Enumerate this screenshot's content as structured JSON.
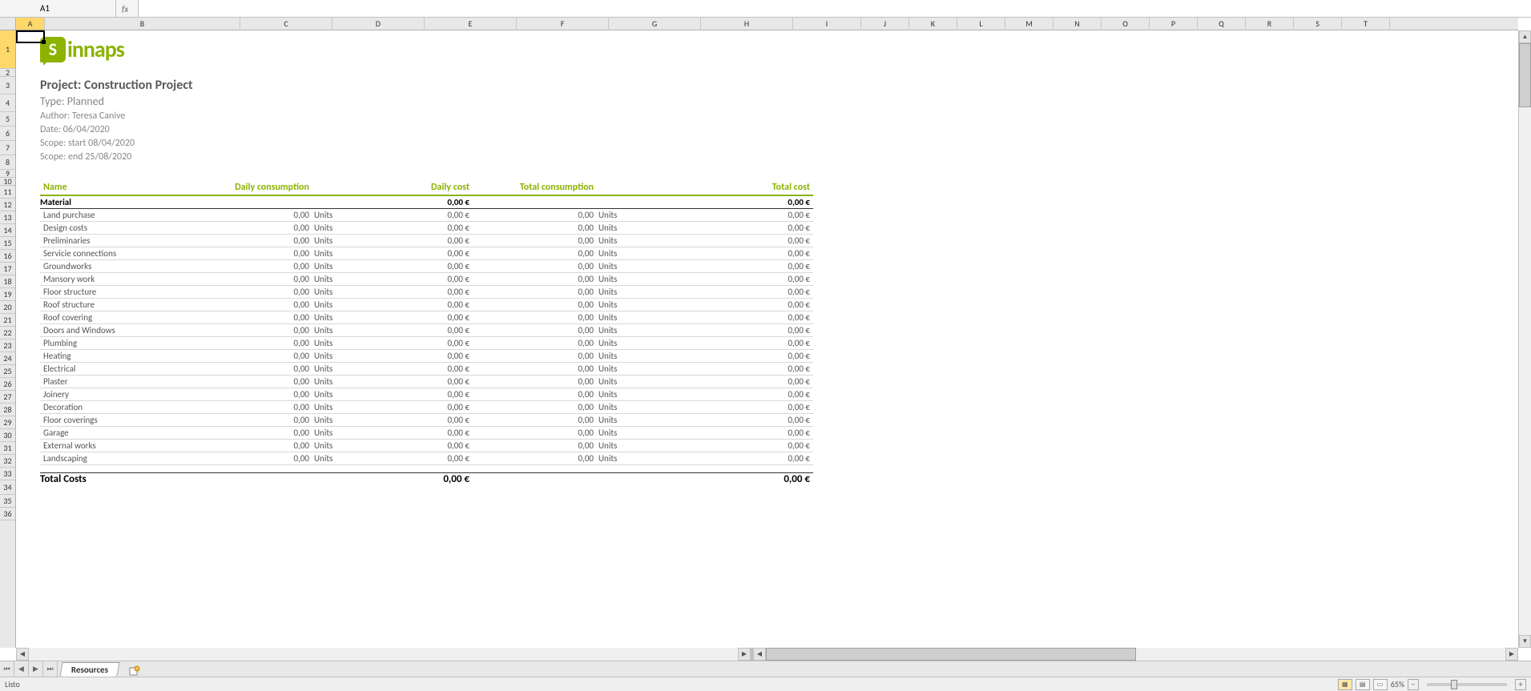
{
  "nameBox": "A1",
  "formula": "",
  "columns": [
    "A",
    "B",
    "C",
    "D",
    "E",
    "F",
    "G",
    "H",
    "I",
    "J",
    "K",
    "L",
    "M",
    "N",
    "O",
    "P",
    "Q",
    "R",
    "S",
    "T"
  ],
  "rowNums": [
    1,
    2,
    3,
    4,
    5,
    6,
    7,
    8,
    9,
    10,
    11,
    12,
    13,
    14,
    15,
    16,
    17,
    18,
    19,
    20,
    21,
    22,
    23,
    24,
    25,
    26,
    27,
    28,
    29,
    30,
    31,
    32,
    33,
    34,
    35,
    36
  ],
  "rowHeights": {
    "1": 48,
    "2": 10,
    "3": 22,
    "4": 22,
    "5": 18,
    "6": 18,
    "7": 18,
    "8": 18,
    "9": 10,
    "10": 10,
    "34": 18
  },
  "logoText": "innaps",
  "project": {
    "title": "Project: Construction Project",
    "type": "Type: Planned",
    "author": "Author: Teresa Canive",
    "date": "Date: 06/04/2020",
    "scopeStart": "Scope: start 08/04/2020",
    "scopeEnd": "Scope: end 25/08/2020"
  },
  "headers": {
    "name": "Name",
    "dailyCons": "Daily consumption",
    "dailyCost": "Daily cost",
    "totalCons": "Total consumption",
    "totalCost": "Total cost"
  },
  "section": {
    "label": "Material",
    "dailyCost": "0,00 €",
    "totalCost": "0,00 €"
  },
  "rows": [
    {
      "name": "Land purchase",
      "dc": "0,00",
      "du": "Units",
      "dcost": "0,00 €",
      "tc": "0,00",
      "tu": "Units",
      "tcost": "0,00 €"
    },
    {
      "name": "Design costs",
      "dc": "0,00",
      "du": "Units",
      "dcost": "0,00 €",
      "tc": "0,00",
      "tu": "Units",
      "tcost": "0,00 €"
    },
    {
      "name": "Preliminaries",
      "dc": "0,00",
      "du": "Units",
      "dcost": "0,00 €",
      "tc": "0,00",
      "tu": "Units",
      "tcost": "0,00 €"
    },
    {
      "name": "Servicie connections",
      "dc": "0,00",
      "du": "Units",
      "dcost": "0,00 €",
      "tc": "0,00",
      "tu": "Units",
      "tcost": "0,00 €"
    },
    {
      "name": "Groundworks",
      "dc": "0,00",
      "du": "Units",
      "dcost": "0,00 €",
      "tc": "0,00",
      "tu": "Units",
      "tcost": "0,00 €"
    },
    {
      "name": "Mansory work",
      "dc": "0,00",
      "du": "Units",
      "dcost": "0,00 €",
      "tc": "0,00",
      "tu": "Units",
      "tcost": "0,00 €"
    },
    {
      "name": "Floor structure",
      "dc": "0,00",
      "du": "Units",
      "dcost": "0,00 €",
      "tc": "0,00",
      "tu": "Units",
      "tcost": "0,00 €"
    },
    {
      "name": "Roof structure",
      "dc": "0,00",
      "du": "Units",
      "dcost": "0,00 €",
      "tc": "0,00",
      "tu": "Units",
      "tcost": "0,00 €"
    },
    {
      "name": "Roof covering",
      "dc": "0,00",
      "du": "Units",
      "dcost": "0,00 €",
      "tc": "0,00",
      "tu": "Units",
      "tcost": "0,00 €"
    },
    {
      "name": "Doors and Windows",
      "dc": "0,00",
      "du": "Units",
      "dcost": "0,00 €",
      "tc": "0,00",
      "tu": "Units",
      "tcost": "0,00 €"
    },
    {
      "name": "Plumbing",
      "dc": "0,00",
      "du": "Units",
      "dcost": "0,00 €",
      "tc": "0,00",
      "tu": "Units",
      "tcost": "0,00 €"
    },
    {
      "name": "Heating",
      "dc": "0,00",
      "du": "Units",
      "dcost": "0,00 €",
      "tc": "0,00",
      "tu": "Units",
      "tcost": "0,00 €"
    },
    {
      "name": "Electrical",
      "dc": "0,00",
      "du": "Units",
      "dcost": "0,00 €",
      "tc": "0,00",
      "tu": "Units",
      "tcost": "0,00 €"
    },
    {
      "name": "Plaster",
      "dc": "0,00",
      "du": "Units",
      "dcost": "0,00 €",
      "tc": "0,00",
      "tu": "Units",
      "tcost": "0,00 €"
    },
    {
      "name": "Joinery",
      "dc": "0,00",
      "du": "Units",
      "dcost": "0,00 €",
      "tc": "0,00",
      "tu": "Units",
      "tcost": "0,00 €"
    },
    {
      "name": "Decoration",
      "dc": "0,00",
      "du": "Units",
      "dcost": "0,00 €",
      "tc": "0,00",
      "tu": "Units",
      "tcost": "0,00 €"
    },
    {
      "name": "Floor coverings",
      "dc": "0,00",
      "du": "Units",
      "dcost": "0,00 €",
      "tc": "0,00",
      "tu": "Units",
      "tcost": "0,00 €"
    },
    {
      "name": "Garage",
      "dc": "0,00",
      "du": "Units",
      "dcost": "0,00 €",
      "tc": "0,00",
      "tu": "Units",
      "tcost": "0,00 €"
    },
    {
      "name": "External works",
      "dc": "0,00",
      "du": "Units",
      "dcost": "0,00 €",
      "tc": "0,00",
      "tu": "Units",
      "tcost": "0,00 €"
    },
    {
      "name": "Landscaping",
      "dc": "0,00",
      "du": "Units",
      "dcost": "0,00 €",
      "tc": "0,00",
      "tu": "Units",
      "tcost": "0,00 €"
    }
  ],
  "total": {
    "label": "Total Costs",
    "daily": "0,00 €",
    "total": "0,00 €"
  },
  "sheetTab": "Resources",
  "status": "Listo",
  "zoom": "65%"
}
